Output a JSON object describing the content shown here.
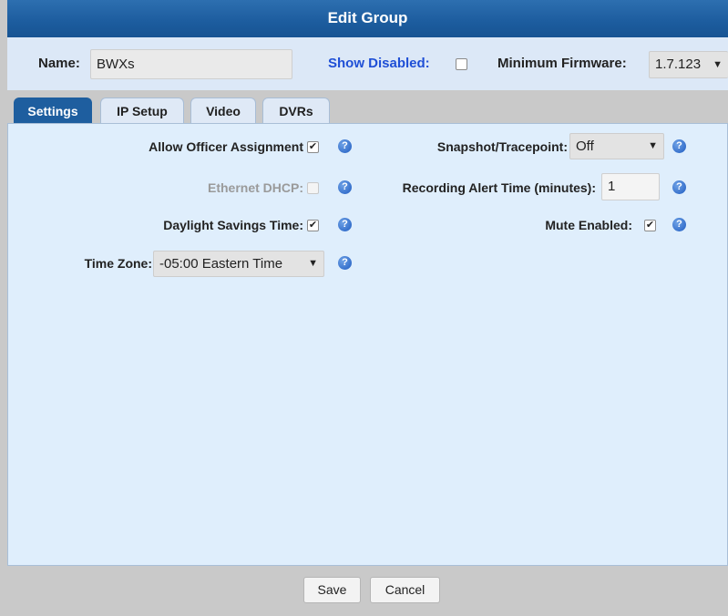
{
  "dialog": {
    "title": "Edit Group"
  },
  "header": {
    "name_label": "Name:",
    "name_value": "BWXs",
    "show_disabled_label": "Show Disabled:",
    "show_disabled_checked": false,
    "min_firmware_label": "Minimum Firmware:",
    "min_firmware_value": "1.7.123"
  },
  "tabs": [
    {
      "label": "Settings",
      "active": true
    },
    {
      "label": "IP Setup",
      "active": false
    },
    {
      "label": "Video",
      "active": false
    },
    {
      "label": "DVRs",
      "active": false
    }
  ],
  "settings": {
    "allow_officer": {
      "label": "Allow Officer Assignment",
      "checked": true
    },
    "ethernet_dhcp": {
      "label": "Ethernet DHCP:",
      "checked": false,
      "disabled": true
    },
    "daylight_savings": {
      "label": "Daylight Savings Time:",
      "checked": true
    },
    "time_zone": {
      "label": "Time Zone:",
      "value": "-05:00 Eastern Time"
    },
    "snapshot": {
      "label": "Snapshot/Tracepoint:",
      "value": "Off"
    },
    "recording_alert": {
      "label": "Recording Alert Time (minutes):",
      "value": "1"
    },
    "mute_enabled": {
      "label": "Mute Enabled:",
      "checked": true
    }
  },
  "footer": {
    "save_label": "Save",
    "cancel_label": "Cancel"
  },
  "icons": {
    "help": "question-mark",
    "check": "✔",
    "arrow": "▼"
  },
  "colors": {
    "title_bg": "#1c5c9e",
    "panel_bg": "#dfeefc",
    "accent_link": "#1f4fd6"
  }
}
